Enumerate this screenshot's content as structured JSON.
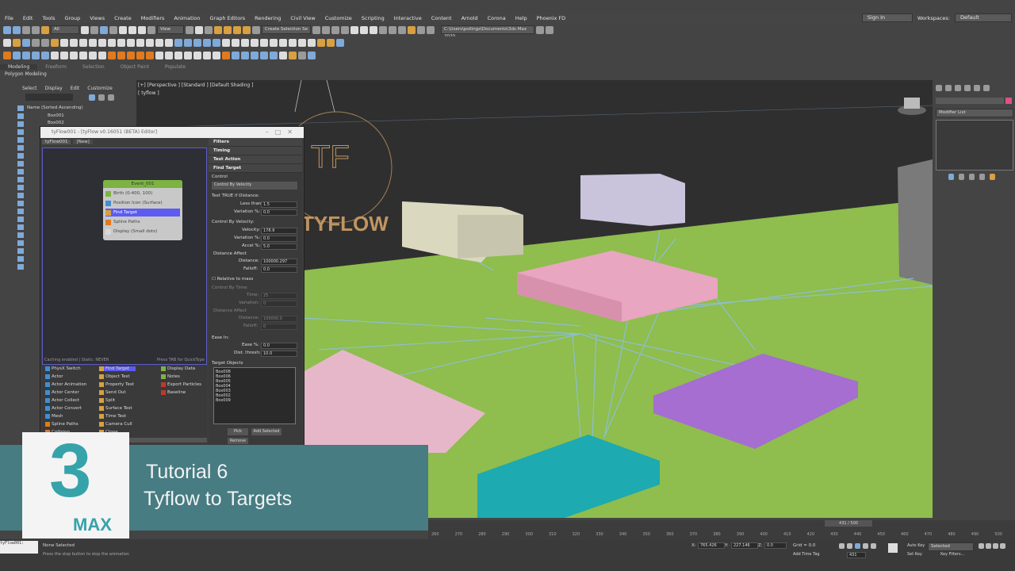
{
  "menu": {
    "items": [
      "File",
      "Edit",
      "Tools",
      "Group",
      "Views",
      "Create",
      "Modifiers",
      "Animation",
      "Graph Editors",
      "Rendering",
      "Civil View",
      "Customize",
      "Scripting",
      "Interactive",
      "Content",
      "Arnold",
      "Corona",
      "Help",
      "Phoenix FD"
    ],
    "sign_in": "Sign In",
    "workspaces_label": "Workspaces:",
    "workspace_value": "Default"
  },
  "toolbar": {
    "selection_filter": "All",
    "view_dropdown": "View",
    "create_selection_set": "Create Selection Se",
    "project_path": "C:\\Users\\pollings\\Documents\\3ds Max 2020"
  },
  "ribbon": {
    "tabs": [
      "Modeling",
      "Freeform",
      "Selection",
      "Object Paint",
      "Populate"
    ],
    "active": "Modeling",
    "subtitle": "Polygon Modeling"
  },
  "scene_explorer": {
    "menu": [
      "Select",
      "Display",
      "Edit",
      "Customize"
    ],
    "header": "Name (Sorted Ascending)",
    "items": [
      "Box001",
      "Box002"
    ]
  },
  "viewport": {
    "label": "[+] [Perspective ] [Standard ] [Default Shading ]",
    "sublabel": "[ tyflow ]",
    "logo_text": "TYFLOW",
    "logo_mark": "TF"
  },
  "tyflow": {
    "title": "tyFlow001 - [tyFlow v0.16051 (BETA) Editor]",
    "tabs": [
      "tyFlow001",
      "[New]"
    ],
    "canvas_status_left": "Caching enabled | Static: NEVER",
    "canvas_status_right": "Press TAB for QuickType",
    "event": {
      "name": "Event_001",
      "operators": [
        "Birth (0-400, 100)",
        "Position Icon (Surface)",
        "Find Target",
        "Spline Paths",
        "Display (Small dots)"
      ],
      "selected": "Find Target"
    },
    "operators_col1": [
      "PhysX Switch",
      "Actor",
      "Actor Animation",
      "Actor Center",
      "Actor Collect",
      "Actor Convert",
      "Mesh",
      "Spline Paths",
      "Collision"
    ],
    "operators_col2": [
      "Find Target",
      "Object Test",
      "Property Test",
      "Send Out",
      "Split",
      "Surface Test",
      "Time Test",
      "Camera Cull",
      "Clone"
    ],
    "operators_col3": [
      "Display Data",
      "Notes",
      "Export Particles",
      "Baseline"
    ],
    "props": {
      "sections": [
        "Filters",
        "Timing",
        "Test Action",
        "Find Target"
      ],
      "control_label": "Control",
      "control_value": "Control By Velocity",
      "test_true": "Test TRUE if Distance:",
      "less_than_label": "Less than:",
      "less_than": "1.5",
      "variation_label": "Variation %:",
      "variation": "0.0",
      "cbv_label": "Control By Velocity:",
      "velocity_label": "Velocity:",
      "velocity": "178.9",
      "var2_label": "Variation %:",
      "var2": "0.0",
      "accel_label": "Accel %:",
      "accel": "5.0",
      "dist_affect": "Distance Affect",
      "distance_label": "Distance:",
      "distance": "100000.297",
      "falloff_label": "Falloff:",
      "falloff": "0.0",
      "relative_mass": "Relative to mass",
      "cbt_label": "Control By Time:",
      "time_label": "Time:",
      "time": "25",
      "t_var_label": "Variation:",
      "t_var": "0",
      "t_dist_affect": "Distance Affect",
      "t_distance_label": "Distance:",
      "t_distance": "100000.0",
      "t_falloff_label": "Falloff:",
      "t_falloff": "0",
      "ease_in": "Ease In:",
      "ease_label": "Ease %:",
      "ease": "0.0",
      "dist_thresh_label": "Dist. thresh:",
      "dist_thresh": "10.0",
      "targets_label": "Target Objects",
      "targets": [
        "Box008",
        "Box006",
        "Box005",
        "Box004",
        "Box003",
        "Box002",
        "Box009"
      ],
      "pick": "Pick",
      "add_selected": "Add Selected",
      "remove": "Remove"
    }
  },
  "right_panel": {
    "modifier_list": "Modifier List"
  },
  "banner": {
    "line1": "Tutorial 6",
    "line2": "Tyflow to Targets",
    "logo_number": "3",
    "logo_text": "MAX"
  },
  "timeline": {
    "frame": "431 / 500",
    "ticks": [
      "260",
      "270",
      "280",
      "290",
      "300",
      "310",
      "320",
      "330",
      "340",
      "350",
      "360",
      "370",
      "380",
      "390",
      "400",
      "410",
      "420",
      "430",
      "440",
      "450",
      "460",
      "470",
      "480",
      "490",
      "500"
    ]
  },
  "status": {
    "script_field": "tyFlow001:",
    "selection": "None Selected",
    "prompt": "Press the stop button to stop the animation",
    "x_label": "X:",
    "x_value": "765.426",
    "y_label": "Y:",
    "y_value": "227.146",
    "z_label": "Z:",
    "z_value": "0.0",
    "grid": "Grid = 0.0",
    "add_time_tag": "Add Time Tag",
    "auto_key": "Auto Key",
    "set_key": "Set Key",
    "selected": "Selected",
    "key_filters": "Key Filters...",
    "frame_num": "431"
  },
  "colors": {
    "grass": "#8fbd4e",
    "box_pink": "#e8a6c0",
    "box_purple": "#a56ed0",
    "box_teal": "#1daab0",
    "box_cream": "#dbd8c0",
    "box_lavender": "#c9c3dc",
    "banner": "#467c82",
    "logo_teal": "#36a3aa"
  }
}
